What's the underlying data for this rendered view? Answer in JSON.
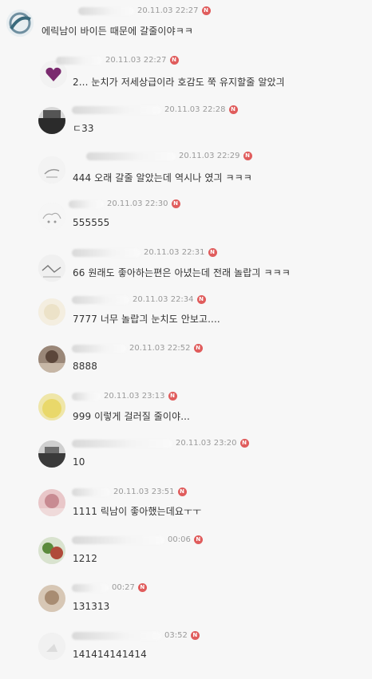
{
  "comments": [
    {
      "time": "20.11.03 22:27",
      "badge": "N",
      "text": "에릭남이 바이든 때문에 갈줄이야ㅋㅋ",
      "avatar": "globe-avatar",
      "reply": false
    },
    {
      "time": "20.11.03 22:27",
      "badge": "N",
      "text": "2... 눈치가 저세상급이라 호감도 쭉 유지할줄 알았긔",
      "avatar": "heart-avatar",
      "reply": true
    },
    {
      "time": "20.11.03 22:28",
      "badge": "N",
      "text": "ㄷ33",
      "avatar": "dark-avatar",
      "reply": true
    },
    {
      "time": "20.11.03 22:29",
      "badge": "N",
      "text": "444 오래 갈줄 알았는데 역시나 였긔 ㅋㅋㅋ",
      "avatar": "sketch-avatar",
      "reply": true
    },
    {
      "time": "20.11.03 22:30",
      "badge": "N",
      "text": "555555",
      "avatar": "cloud-avatar",
      "reply": true
    },
    {
      "time": "20.11.03 22:31",
      "badge": "N",
      "text": "66 원래도 좋아하는편은 아녔는데 전래 놀랍긔 ㅋㅋㅋ",
      "avatar": "sketch-avatar",
      "reply": true
    },
    {
      "time": "20.11.03 22:34",
      "badge": "N",
      "text": "7777 너무 놀랍긔 눈치도 안보고....",
      "avatar": "beige-avatar",
      "reply": true
    },
    {
      "time": "20.11.03 22:52",
      "badge": "N",
      "text": "8888",
      "avatar": "photo-avatar",
      "reply": true
    },
    {
      "time": "20.11.03 23:13",
      "badge": "N",
      "text": "999 이렇게 걸러질 줄이야...",
      "avatar": "yellow-avatar",
      "reply": true
    },
    {
      "time": "20.11.03 23:20",
      "badge": "N",
      "text": "10",
      "avatar": "car-avatar",
      "reply": true
    },
    {
      "time": "20.11.03 23:51",
      "badge": "N",
      "text": "1111 릭남이 좋아했는데요ㅜㅜ",
      "avatar": "pink-avatar",
      "reply": true
    },
    {
      "time": "00:06",
      "badge": "N",
      "text": "1212",
      "avatar": "plant-avatar",
      "reply": true
    },
    {
      "time": "00:27",
      "badge": "N",
      "text": "131313",
      "avatar": "tan-avatar",
      "reply": true
    },
    {
      "time": "03:52",
      "badge": "N",
      "text": "141414141414",
      "avatar": "white-avatar",
      "reply": true
    }
  ]
}
